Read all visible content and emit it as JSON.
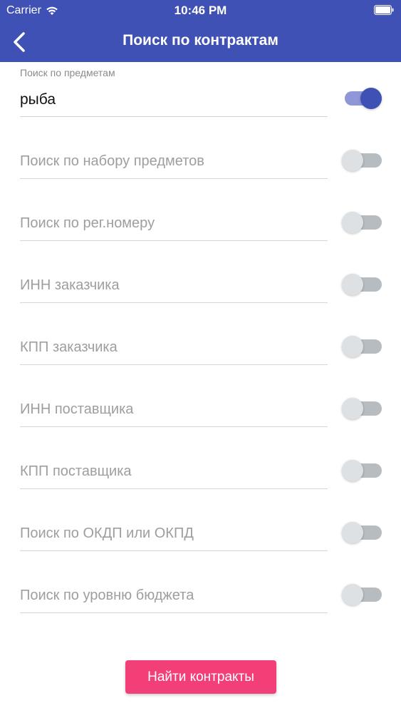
{
  "status_bar": {
    "carrier": "Carrier",
    "time": "10:46 PM"
  },
  "nav": {
    "back_icon": "chevron-left-icon",
    "title": "Поиск по контрактам"
  },
  "colors": {
    "primary": "#3f51b5",
    "accent": "#f23f78",
    "placeholder": "#9e9e9e",
    "divider": "#d6d6d6"
  },
  "fields": [
    {
      "label": "Поиск по предметам",
      "value": "рыба",
      "toggle_on": true
    },
    {
      "placeholder": "Поиск по набору предметов",
      "toggle_on": false
    },
    {
      "placeholder": "Поиск по рег.номеру",
      "toggle_on": false
    },
    {
      "placeholder": "ИНН заказчика",
      "toggle_on": false
    },
    {
      "placeholder": "КПП заказчика",
      "toggle_on": false
    },
    {
      "placeholder": "ИНН поставщика",
      "toggle_on": false
    },
    {
      "placeholder": "КПП поставщика",
      "toggle_on": false
    },
    {
      "placeholder": "Поиск по ОКДП или ОКПД",
      "toggle_on": false
    },
    {
      "placeholder": "Поиск по уровню бюджета",
      "toggle_on": false
    }
  ],
  "submit": {
    "label": "Найти контракты"
  }
}
